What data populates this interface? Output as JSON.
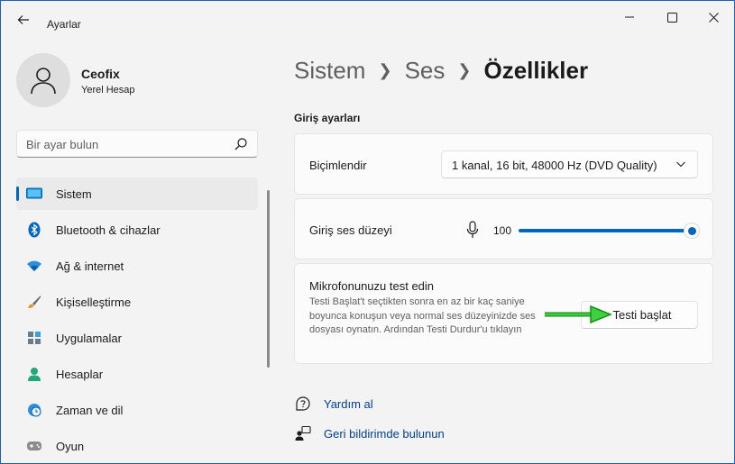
{
  "window": {
    "title": "Ayarlar"
  },
  "user": {
    "name": "Ceofix",
    "account": "Yerel Hesap"
  },
  "search": {
    "placeholder": "Bir ayar bulun"
  },
  "sidebar": {
    "items": [
      {
        "label": "Sistem",
        "icon": "system-icon",
        "active": true
      },
      {
        "label": "Bluetooth & cihazlar",
        "icon": "bluetooth-icon"
      },
      {
        "label": "Ağ & internet",
        "icon": "wifi-icon"
      },
      {
        "label": "Kişiselleştirme",
        "icon": "brush-icon"
      },
      {
        "label": "Uygulamalar",
        "icon": "apps-icon"
      },
      {
        "label": "Hesaplar",
        "icon": "account-icon"
      },
      {
        "label": "Zaman ve dil",
        "icon": "clock-globe-icon"
      },
      {
        "label": "Oyun",
        "icon": "gamepad-icon"
      }
    ]
  },
  "breadcrumb": {
    "items": [
      "Sistem",
      "Ses"
    ],
    "current": "Özellikler"
  },
  "input_settings": {
    "section_title": "Giriş ayarları",
    "format": {
      "label": "Biçimlendir",
      "value": "1 kanal, 16 bit, 48000 Hz (DVD Quality)"
    },
    "volume": {
      "label": "Giriş ses düzeyi",
      "value": "100",
      "level": 1.0
    },
    "test": {
      "title": "Mikrofonunuzu test edin",
      "description": "Testi Başlat't seçtikten sonra en az bir kaç saniye boyunca konuşun veya normal ses düzeyinizde ses dosyası oynatın. Ardından Testi Durdur'u tıklayın",
      "button": "Testi başlat"
    }
  },
  "links": [
    {
      "label": "Yardım al",
      "icon": "help-icon"
    },
    {
      "label": "Geri bildirimde bulunun",
      "icon": "feedback-icon"
    }
  ],
  "colors": {
    "accent": "#0067c0",
    "arrow": "#22b022",
    "link": "#003e92"
  }
}
